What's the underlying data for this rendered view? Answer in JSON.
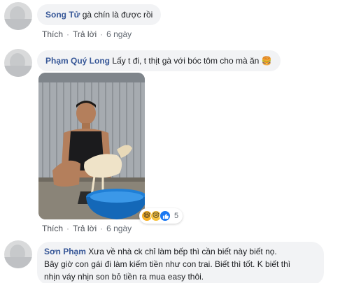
{
  "comments": [
    {
      "author": "Song Tử",
      "text": "gà chín là được rồi",
      "like_label": "Thích",
      "reply_label": "Trả lời",
      "time": "6 ngày"
    },
    {
      "author": "Phạm Quý Long",
      "text": "Lấy t đi, t thịt gà với bóc tôm cho mà ăn 🍔",
      "like_label": "Thích",
      "reply_label": "Trả lời",
      "time": "6 ngày",
      "reactions": {
        "icons": [
          "haha-icon",
          "sad-icon",
          "like-icon"
        ],
        "count": "5"
      }
    },
    {
      "author": "Sơn Phạm",
      "lines": [
        "Xưa về nhà ck chỉ làm bếp thì cần biết này biết nọ.",
        "Bây giờ con gái đi làm kiếm tiền như con trai. Biết thì tốt. K biết thì",
        "nhịn váy nhịn son bỏ tiền ra mua easy thôi."
      ]
    }
  ],
  "colors": {
    "author": "#385898",
    "bubble": "#f2f3f5",
    "meta": "#606770",
    "like_reaction": "#1877f2"
  }
}
